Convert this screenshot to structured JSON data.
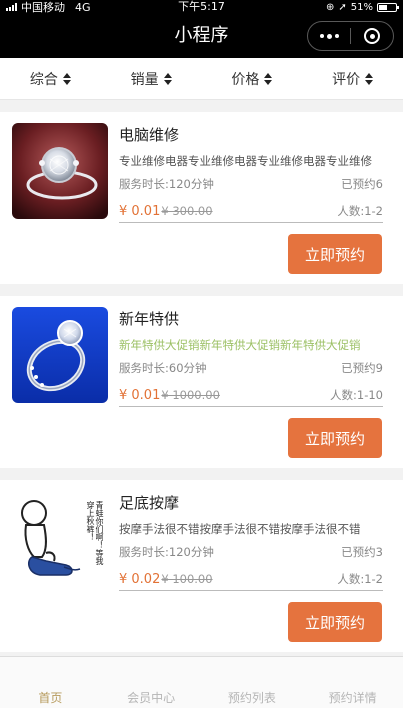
{
  "status_bar": {
    "carrier": "中国移动",
    "network": "4G",
    "time": "下午5:17",
    "battery": "51%",
    "battery_level": 0.51
  },
  "nav": {
    "title": "小程序",
    "more_icon": "more-dots-icon",
    "close_icon": "target-circle-icon"
  },
  "sort_bar": {
    "items": [
      {
        "label": "综合"
      },
      {
        "label": "销量"
      },
      {
        "label": "价格"
      },
      {
        "label": "评价"
      }
    ]
  },
  "services": [
    {
      "title": "电脑维修",
      "description": "专业维修电器专业维修电器专业维修电器专业维修",
      "description_color": "#555555",
      "duration": "服务时长:120分钟",
      "booked": "已预约6",
      "price": "¥ 0.01",
      "original_price": "¥ 300.00",
      "people": "人数:1-2",
      "button": "立即预约"
    },
    {
      "title": "新年特供",
      "description": "新年特供大促销新年特供大促销新年特供大促销",
      "description_color": "#9bc064",
      "duration": "服务时长:60分钟",
      "booked": "已预约9",
      "price": "¥ 0.01",
      "original_price": "¥ 1000.00",
      "people": "人数:1-10",
      "button": "立即预约"
    },
    {
      "title": "足底按摩",
      "description": "按摩手法很不错按摩手法很不错按摩手法很不错",
      "description_color": "#555555",
      "duration": "服务时长:120分钟",
      "booked": "已预约3",
      "price": "¥ 0.02",
      "original_price": "¥ 100.00",
      "people": "人数:1-2",
      "button": "立即预约",
      "image_text": "青蛙你们啊！等我穿上秋裤！"
    }
  ],
  "tabbar": {
    "items": [
      {
        "label": "首页",
        "active": true
      },
      {
        "label": "会员中心",
        "active": false
      },
      {
        "label": "预约列表",
        "active": false
      },
      {
        "label": "预约详情",
        "active": false
      }
    ]
  },
  "colors": {
    "accent": "#e5733e",
    "price": "#e27236",
    "tab_active": "#b69a5c",
    "nav_bg": "#000000"
  }
}
